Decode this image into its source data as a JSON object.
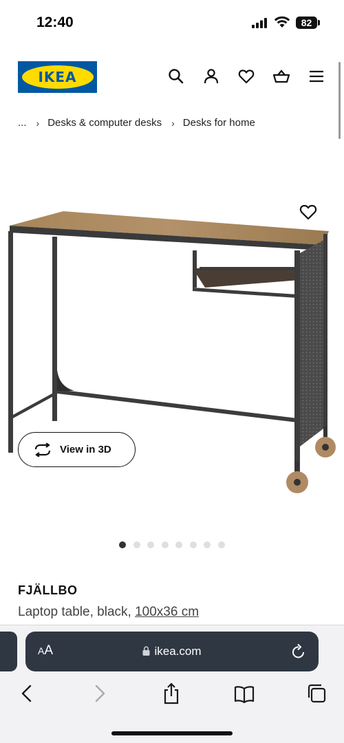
{
  "status_bar": {
    "time": "12:40",
    "battery": "82"
  },
  "header": {
    "logo_text": "IKEA",
    "icons": [
      "search-icon",
      "user-icon",
      "heart-icon",
      "basket-icon",
      "menu-icon"
    ]
  },
  "breadcrumb": {
    "items": [
      "...",
      "Desks & computer desks",
      "Desks for home"
    ]
  },
  "product": {
    "view_3d_label": "View in 3D",
    "image_count": 8,
    "active_image": 1,
    "name": "FJÄLLBO",
    "description": "Laptop table, black,",
    "size": "100x36 cm"
  },
  "browser": {
    "aa_label_small": "A",
    "aa_label_large": "A",
    "url": "ikea.com"
  },
  "colors": {
    "ikea_blue": "#0058a3",
    "ikea_yellow": "#ffdb00",
    "urlbar_bg": "#2f3743"
  }
}
